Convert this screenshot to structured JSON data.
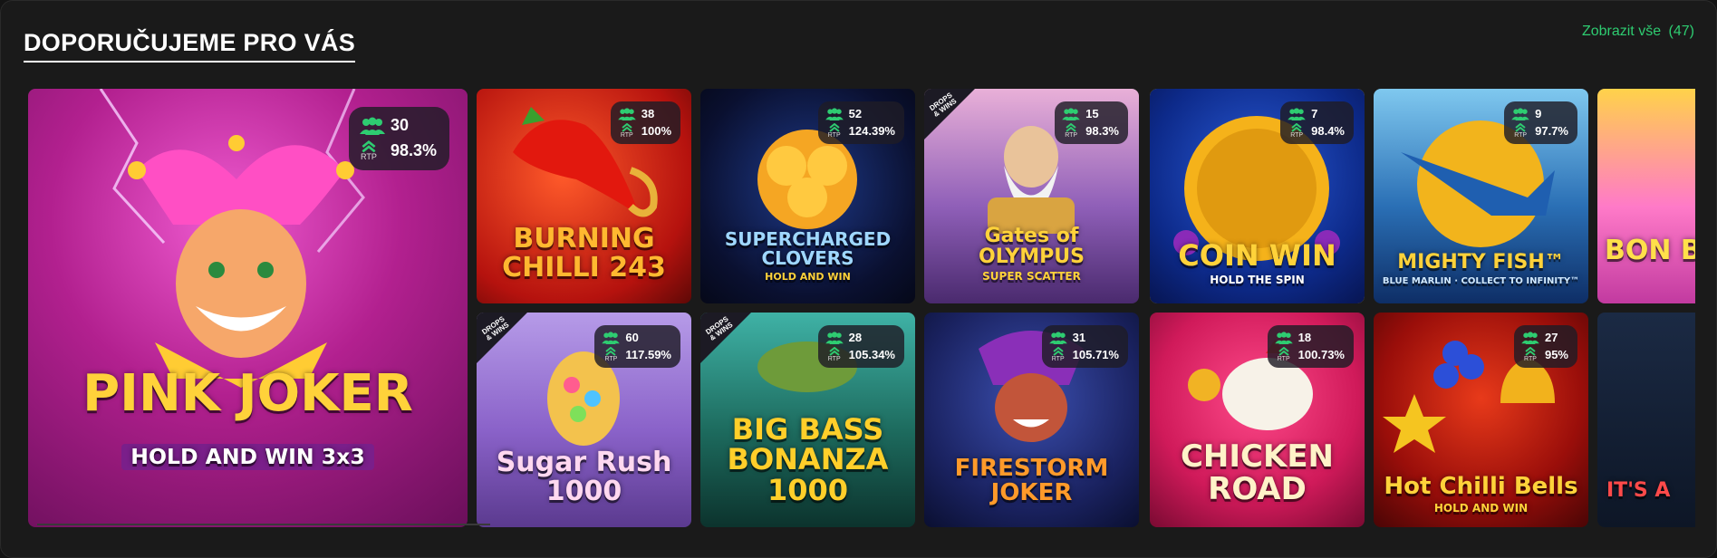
{
  "section": {
    "title": "DOPORUČUJEME PRO VÁS",
    "view_all_label": "Zobrazit vše",
    "view_all_count": "(47)"
  },
  "rtp_label": "RTP",
  "drops_label": "DROPS & WINS",
  "colors": {
    "accent": "#2ecc71",
    "badge_bg": "#1e1c26",
    "selected_border": "#f5c400"
  },
  "featured": {
    "name": "PINK JOKER",
    "subtitle": "HOLD AND WIN 3x3",
    "players": "30",
    "rtp": "98.3%"
  },
  "games": [
    {
      "name": "BURNING CHILLI 243",
      "subtitle": "",
      "players": "38",
      "rtp": "100%",
      "drops": false,
      "selected": false
    },
    {
      "name": "SUPERCHARGED CLOVERS",
      "subtitle": "HOLD AND WIN",
      "players": "52",
      "rtp": "124.39%",
      "drops": false,
      "selected": false
    },
    {
      "name": "Gates of OLYMPUS",
      "subtitle": "SUPER SCATTER",
      "players": "15",
      "rtp": "98.3%",
      "drops": true,
      "selected": false
    },
    {
      "name": "COIN WIN",
      "subtitle": "HOLD THE SPIN",
      "players": "7",
      "rtp": "98.4%",
      "drops": false,
      "selected": true
    },
    {
      "name": "MIGHTY FISH™",
      "subtitle": "BLUE MARLIN · COLLECT TO INFINITY™",
      "players": "9",
      "rtp": "97.7%",
      "drops": false,
      "selected": false
    },
    {
      "name": "BON BILL",
      "subtitle": "",
      "players": "",
      "rtp": "",
      "drops": false,
      "selected": false
    },
    {
      "name": "Sugar Rush 1000",
      "subtitle": "",
      "players": "60",
      "rtp": "117.59%",
      "drops": true,
      "selected": false
    },
    {
      "name": "BIG BASS BONANZA 1000",
      "subtitle": "",
      "players": "28",
      "rtp": "105.34%",
      "drops": true,
      "selected": false
    },
    {
      "name": "FIRESTORM JOKER",
      "subtitle": "",
      "players": "31",
      "rtp": "105.71%",
      "drops": false,
      "selected": false
    },
    {
      "name": "CHICKEN ROAD",
      "subtitle": "",
      "players": "18",
      "rtp": "100.73%",
      "drops": false,
      "selected": false
    },
    {
      "name": "Hot Chilli Bells",
      "subtitle": "HOLD AND WIN",
      "players": "27",
      "rtp": "95%",
      "drops": false,
      "selected": false
    },
    {
      "name": "IT'S A",
      "subtitle": "",
      "players": "",
      "rtp": "",
      "drops": false,
      "selected": false
    }
  ]
}
